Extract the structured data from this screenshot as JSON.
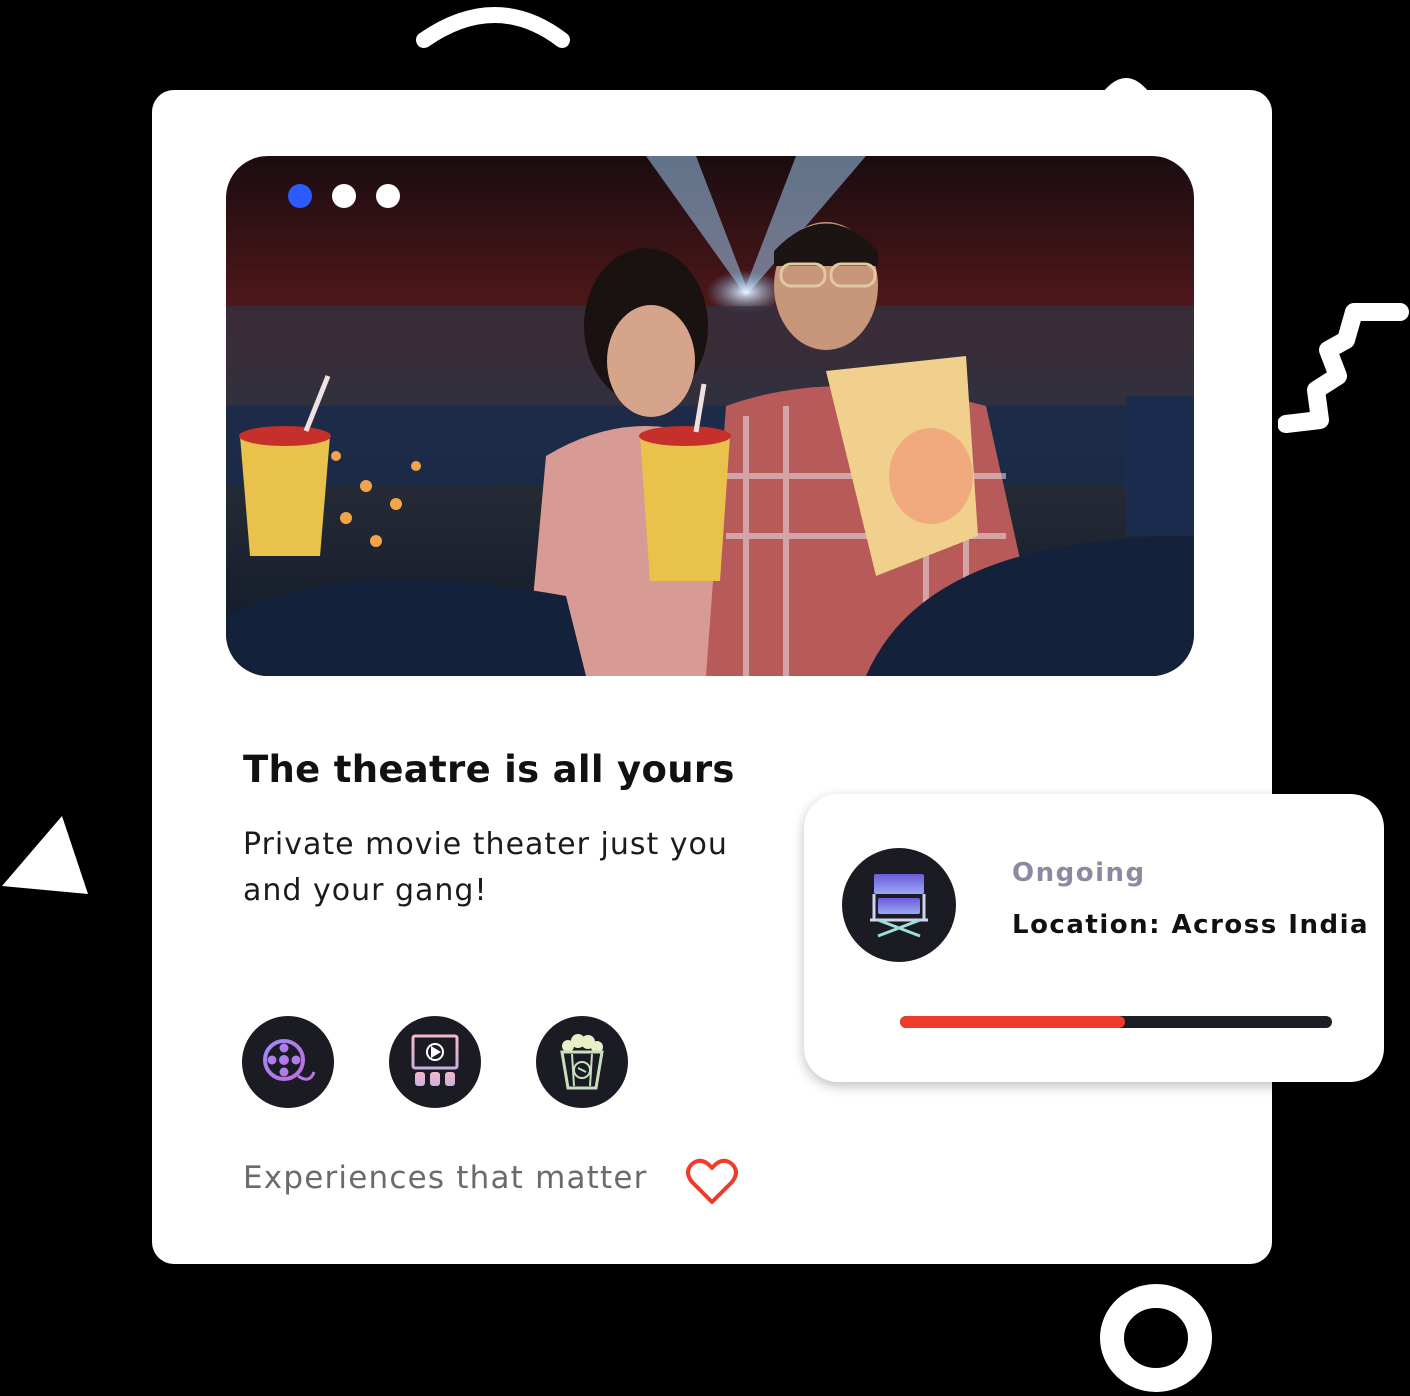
{
  "hero": {
    "carousel_total": 3,
    "carousel_active_index": 0
  },
  "content": {
    "title": "The theatre is all yours",
    "description_line1": "Private movie theater just you",
    "description_line2": "and your gang!",
    "feature_icons": [
      "film-reel-icon",
      "cinema-screen-icon",
      "popcorn-icon"
    ],
    "tagline": "Experiences that matter",
    "heart_icon": "heart-icon"
  },
  "status": {
    "icon": "director-chair-icon",
    "label": "Ongoing",
    "location": "Location: Across India",
    "progress": 0.52
  },
  "colors": {
    "accent_blue": "#2b5bff",
    "progress_red": "#ee3b2a",
    "heart_red": "#ee3b2a",
    "icon_bg": "#1b1b23",
    "status_label": "#8c8aa0"
  }
}
